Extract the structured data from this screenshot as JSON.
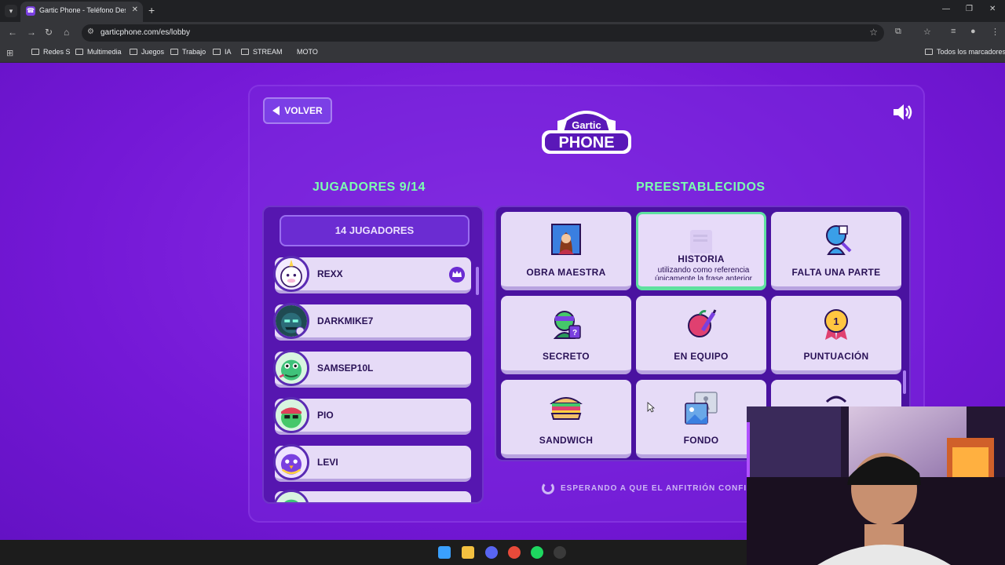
{
  "browser": {
    "tab_title": "Gartic Phone - Teléfono Descon",
    "url": "garticphone.com/es/lobby",
    "bookmarks": [
      "Redes S",
      "Multimedia",
      "Juegos",
      "Trabajo",
      "IA",
      "STREAM",
      "MOTO"
    ],
    "all_bookmarks": "Todos los marcadores"
  },
  "header": {
    "back_label": "VOLVER",
    "logo_top": "Gartic",
    "logo_bottom": "PHONE"
  },
  "players": {
    "title": "JUGADORES 9/14",
    "count_label": "14 JUGADORES",
    "list": [
      {
        "name": "REXX",
        "host": true
      },
      {
        "name": "DARKMIKE7",
        "host": false
      },
      {
        "name": "SAMSEP10L",
        "host": false
      },
      {
        "name": "PIO",
        "host": false
      },
      {
        "name": "LEVI",
        "host": false
      }
    ]
  },
  "presets": {
    "title": "PREESTABLECIDOS",
    "cards": [
      {
        "label": "OBRA MAESTRA",
        "icon": "mona-lisa-icon"
      },
      {
        "label": "HISTORIA",
        "icon": "scroll-icon",
        "selected": true,
        "desc": "utilizando como referencia únicamente la frase anterior"
      },
      {
        "label": "FALTA UNA PARTE",
        "icon": "head-piece-icon"
      },
      {
        "label": "SECRETO",
        "icon": "ninja-icon"
      },
      {
        "label": "EN EQUIPO",
        "icon": "apple-pencil-icon"
      },
      {
        "label": "PUNTUACIÓN",
        "icon": "medal-icon"
      },
      {
        "label": "SANDWICH",
        "icon": "sandwich-icon"
      },
      {
        "label": "FONDO",
        "icon": "background-icon"
      }
    ]
  },
  "status": {
    "waiting": "ESPERANDO A QUE EL ANFITRIÓN CONFIGU"
  },
  "colors": {
    "accent_green": "#7dffb0",
    "purple_bg": "#7418d6",
    "card_bg": "#e6dbf7"
  }
}
